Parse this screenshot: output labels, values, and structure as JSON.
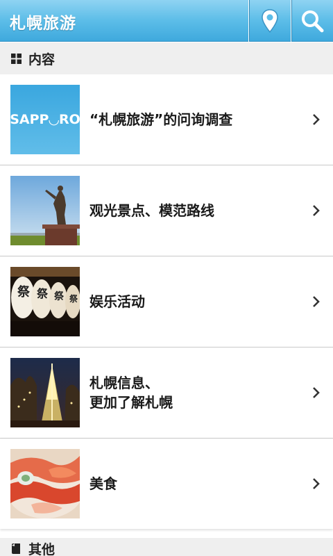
{
  "header": {
    "title": "札幌旅游",
    "location_icon": "map-pin-icon",
    "search_icon": "search-icon"
  },
  "sections": {
    "contents": {
      "label": "内容",
      "icon": "grid-icon"
    },
    "other": {
      "label": "其他",
      "icon": "bookmark-icon"
    }
  },
  "items": [
    {
      "label": "“札幌旅游”的问询调查",
      "thumb_text": "SAPP◡RO",
      "thumb": "sapporo-logo"
    },
    {
      "label": "观光景点、模范路线",
      "thumb": "statue-photo"
    },
    {
      "label": "娱乐活动",
      "thumb": "lanterns-photo"
    },
    {
      "label": "札幌信息、\n更加了解札幌",
      "thumb": "illumination-tree-photo"
    },
    {
      "label": "美食",
      "thumb": "seafood-photo"
    }
  ],
  "colors": {
    "header_top": "#8fd3f2",
    "header_bottom": "#3fa9dd",
    "section_bg": "#efefef"
  }
}
